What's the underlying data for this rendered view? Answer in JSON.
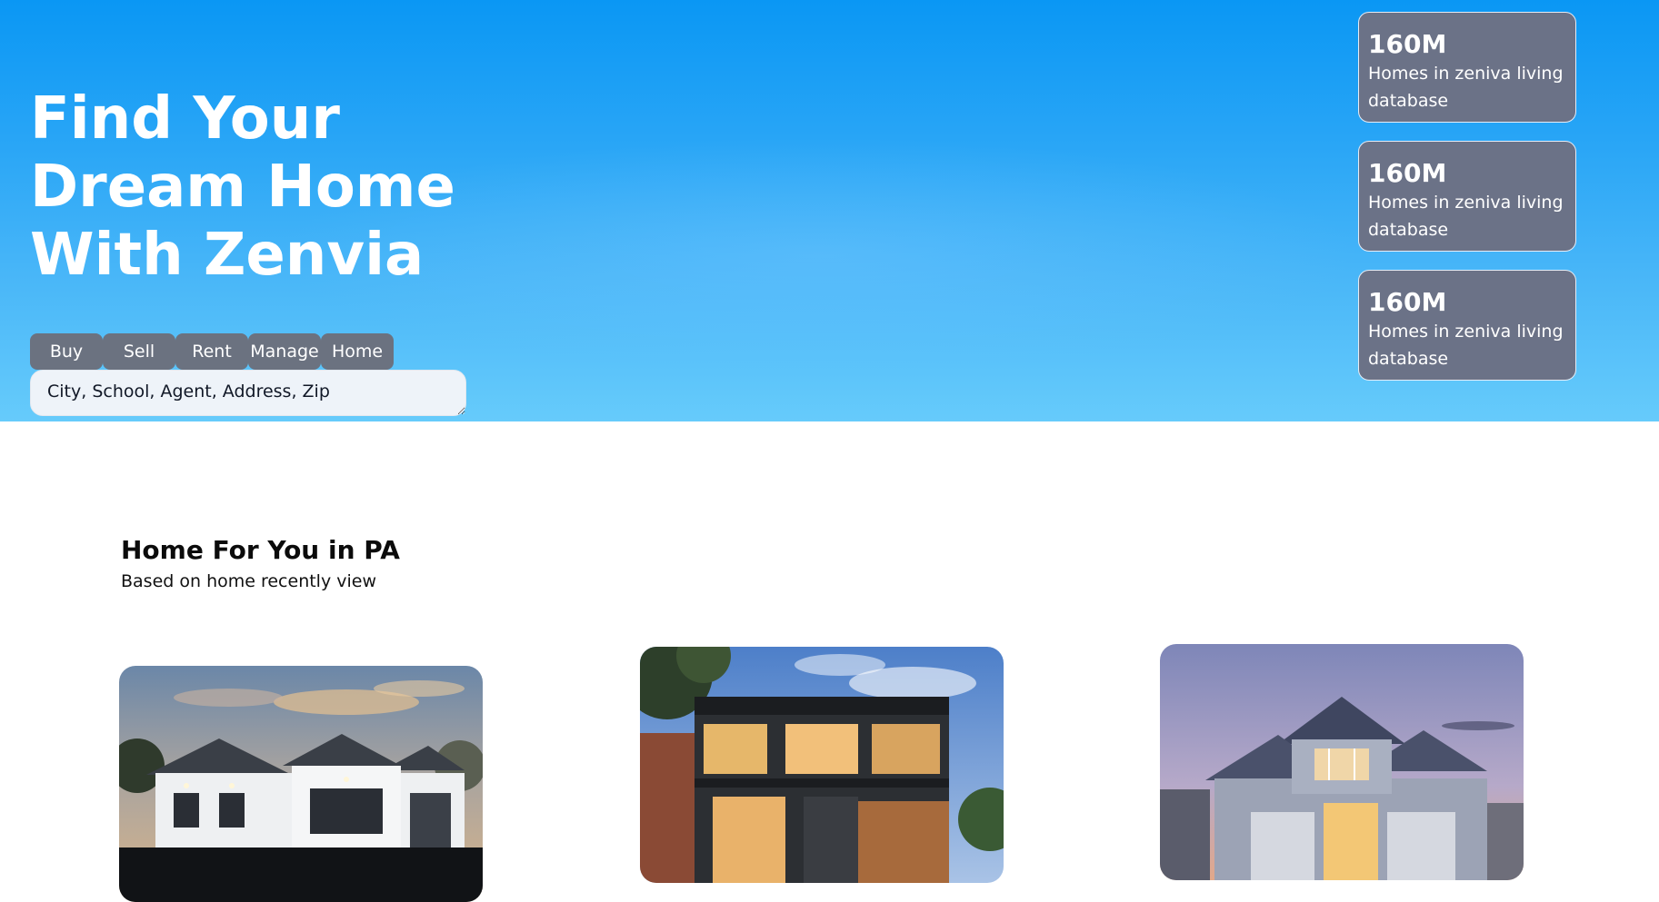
{
  "hero": {
    "title_lines": [
      "Find Your",
      "Dream Home",
      "With Zenvia"
    ],
    "tabs": [
      {
        "label": "Buy"
      },
      {
        "label": "Sell"
      },
      {
        "label": "Rent"
      },
      {
        "label": "Manage"
      },
      {
        "label": "Home"
      }
    ],
    "search": {
      "placeholder": "City, School, Agent, Address, Zip",
      "value": ""
    },
    "stats": [
      {
        "value": "160M",
        "label": "Homes in zeniva living database"
      },
      {
        "value": "160M",
        "label": "Homes in zeniva living database"
      },
      {
        "value": "160M",
        "label": "Homes in zeniva living database"
      }
    ]
  },
  "section": {
    "title": "Home For You in PA",
    "subtitle": "Based on home recently view"
  },
  "listings": [
    {
      "image_icon": "modern-white-house-photo"
    },
    {
      "image_icon": "contemporary-glass-house-photo"
    },
    {
      "image_icon": "suburban-gray-house-photo"
    }
  ],
  "colors": {
    "hero_top": "#0a97f4",
    "hero_bottom": "#66cbfb",
    "tab_bg": "#6b7280",
    "stat_card_bg": "#6b7287",
    "search_bg": "#eef3f9"
  }
}
